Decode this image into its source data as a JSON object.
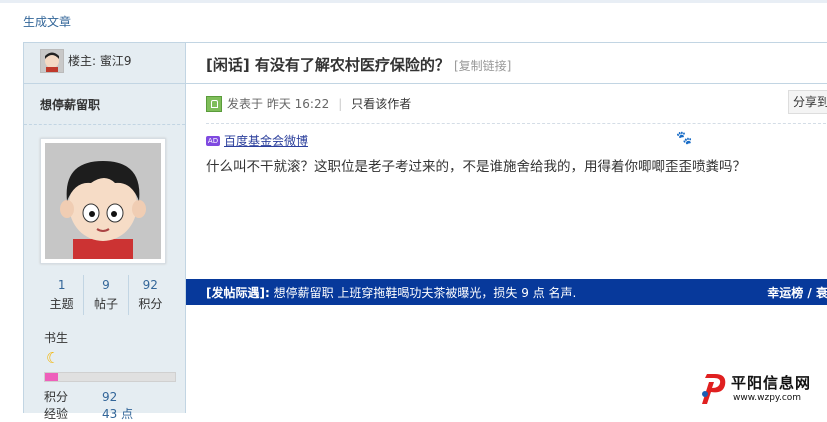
{
  "top": {
    "generate_link": "生成文章"
  },
  "sidebar": {
    "owner_label": "楼主:",
    "owner_name": "蜜江9",
    "username": "想停薪留职",
    "stats": [
      {
        "value": "1",
        "label": "主题"
      },
      {
        "value": "9",
        "label": "帖子"
      },
      {
        "value": "92",
        "label": "积分"
      }
    ],
    "level_name": "书生",
    "level_progress": 0.1,
    "profile": [
      {
        "key": "积分",
        "value": "92"
      },
      {
        "key": "经验",
        "value": "43 点"
      }
    ]
  },
  "post": {
    "title": "[闲话] 有没有了解农村医疗保险的？",
    "copy_link": "[复制链接]",
    "posted_label": "发表于",
    "posted_time": "昨天 16:22",
    "separator": "|",
    "author_only": "只看该作者",
    "share": "分享到",
    "ad_badge": "AD",
    "ad_link": "百度基金会微博",
    "body": "什么叫不干就滚？这职位是老子考过来的，不是谁施舍给我的，用得着你唧唧歪歪喷粪吗？"
  },
  "notice": {
    "label": "[发帖际遇]:",
    "text": "想停薪留职 上班穿拖鞋喝功夫茶被曝光，损失 9 点 名声.",
    "right": "幸运榜 / 衰"
  },
  "watermark": {
    "name": "平阳信息网",
    "url": "www.wzpy.com"
  },
  "colors": {
    "notice_bg": "#07399b",
    "sidebar_bg": "#e5edf2",
    "link": "#336699",
    "level_bar": "#ee5fbb"
  }
}
